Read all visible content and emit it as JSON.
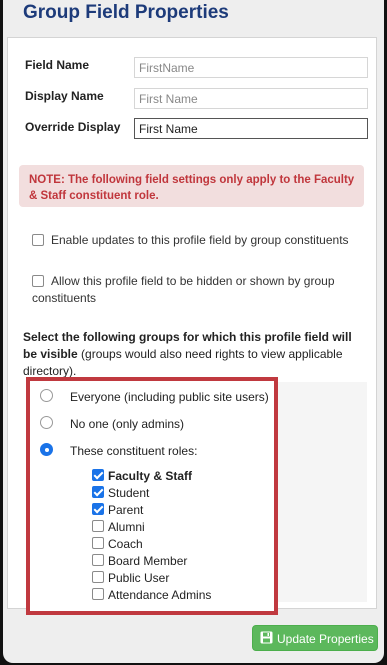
{
  "title": "Group Field Properties",
  "fields": {
    "field_name_label": "Field Name",
    "field_name_placeholder": "FirstName",
    "display_name_label": "Display Name",
    "display_name_placeholder": "First Name",
    "override_label": "Override Display",
    "override_value": "First Name"
  },
  "note": "NOTE: The following field settings only apply to the Faculty & Staff constituent role.",
  "options": {
    "enable_updates": {
      "label": "Enable updates to this profile field by group constituents",
      "checked": false
    },
    "allow_hidden": {
      "label": "Allow this profile field to be hidden or shown by group constituents",
      "checked": false
    }
  },
  "visibility": {
    "heading_bold": "Select the following groups for which this profile field will be visible",
    "heading_rest": " (groups would also need rights to view applicable directory).",
    "radios": [
      {
        "label": "Everyone (including public site users)",
        "selected": false
      },
      {
        "label": "No one (only admins)",
        "selected": false
      },
      {
        "label": "These constituent roles:",
        "selected": true
      }
    ],
    "roles": [
      {
        "label": "Faculty & Staff",
        "checked": true,
        "bold": true
      },
      {
        "label": "Student",
        "checked": true,
        "bold": false
      },
      {
        "label": "Parent",
        "checked": true,
        "bold": false
      },
      {
        "label": "Alumni",
        "checked": false,
        "bold": false
      },
      {
        "label": "Coach",
        "checked": false,
        "bold": false
      },
      {
        "label": "Board Member",
        "checked": false,
        "bold": false
      },
      {
        "label": "Public User",
        "checked": false,
        "bold": false
      },
      {
        "label": "Attendance Admins",
        "checked": false,
        "bold": false
      }
    ]
  },
  "update_button": {
    "label": "Update Properties",
    "icon": "save-icon"
  },
  "colors": {
    "title": "#1d3b7a",
    "note_bg": "#f2dede",
    "note_text": "#c0363c",
    "highlight": "#c0393f",
    "accent": "#1a73e8",
    "button": "#5cb85c"
  }
}
